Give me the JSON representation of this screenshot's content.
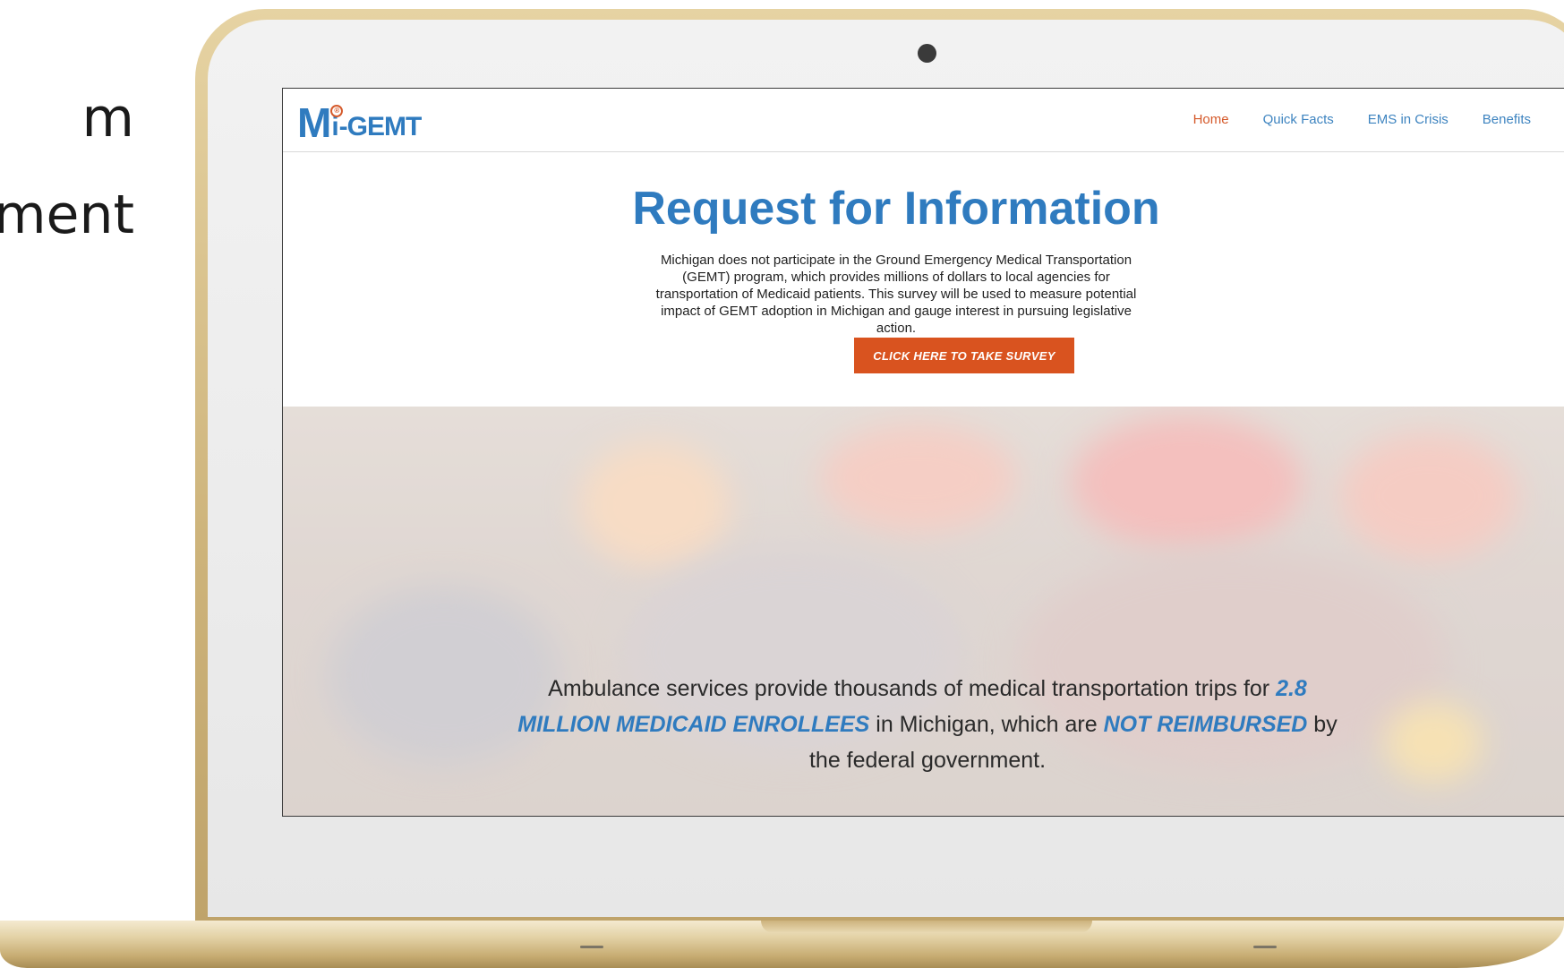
{
  "slide": {
    "line1": "m",
    "line2": "ment"
  },
  "site": {
    "logo": {
      "m": "M",
      "i": "i",
      "rest": "-GEMT",
      "mark": "®"
    },
    "nav": [
      "Home",
      "Quick Facts",
      "EMS in Crisis",
      "Benefits"
    ],
    "title": "Request for Information",
    "body": "Michigan does not participate in the Ground Emergency Medical Transportation (GEMT) program, which provides millions of dollars to local agencies for transportation of Medicaid patients. This survey will be used to measure potential impact of GEMT adoption in Michigan and gauge interest in pursuing legislative action.",
    "survey_button": "CLICK HERE TO TAKE SURVEY",
    "hero": {
      "part1": "Ambulance services provide thousands of medical transportation trips for ",
      "highlight1": "2.8 MILLION MEDICAID ENROLLEES",
      "part2": " in Michigan, which are ",
      "highlight2": "NOT REIMBURSED",
      "part3": " by the federal government."
    }
  },
  "colors": {
    "brand_blue": "#2f7bbf",
    "accent_orange": "#d9531f",
    "laptop_gold": "#cdb37a"
  }
}
